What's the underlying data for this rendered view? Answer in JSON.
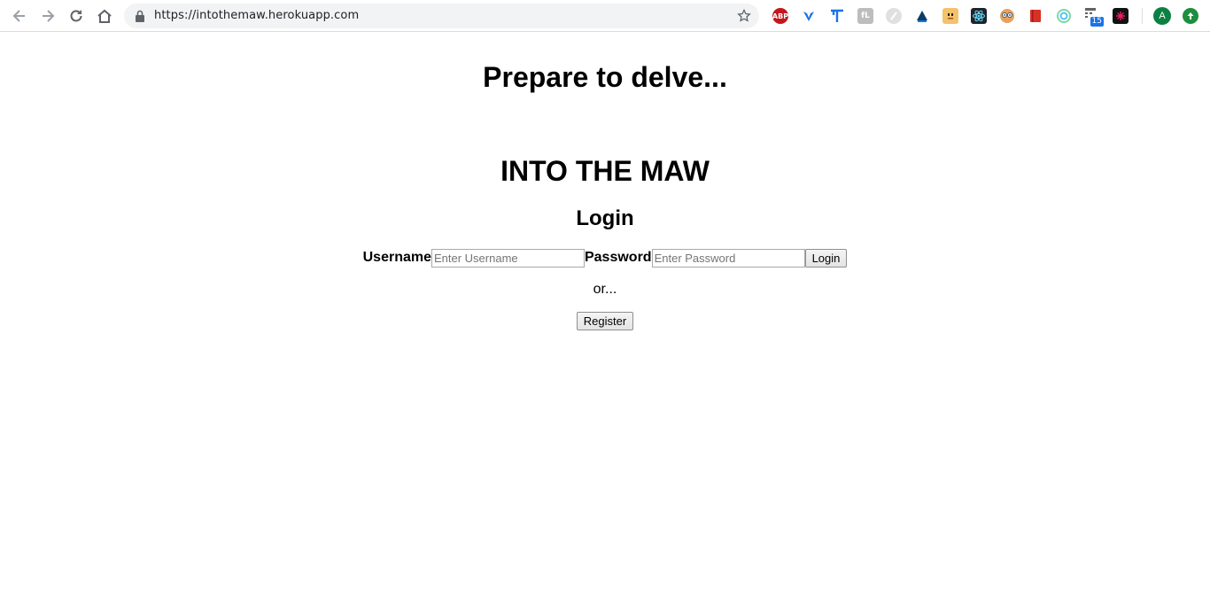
{
  "browser": {
    "url": "https://intothemaw.herokuapp.com",
    "extensions": [
      "adblock-plus-icon",
      "vimeo-like-icon",
      "tampermonkey-icon",
      "puzzle-extension-icon",
      "feather-extension-icon",
      "triangle-extension-icon",
      "box-extension-icon",
      "react-devtools-icon",
      "owl-extension-icon",
      "book-extension-icon",
      "circle-extension-icon",
      "calendar-extension-icon",
      "dark-extension-icon"
    ],
    "ext_labels": {
      "abp": "ABP",
      "calendar_badge": "15"
    },
    "avatar_letter": "A"
  },
  "page": {
    "tagline": "Prepare to delve...",
    "title": "INTO THE MAW",
    "login_heading": "Login",
    "username_label": "Username",
    "username_placeholder": "Enter Username",
    "password_label": "Password",
    "password_placeholder": "Enter Password",
    "login_button": "Login",
    "or_text": "or...",
    "register_button": "Register"
  }
}
